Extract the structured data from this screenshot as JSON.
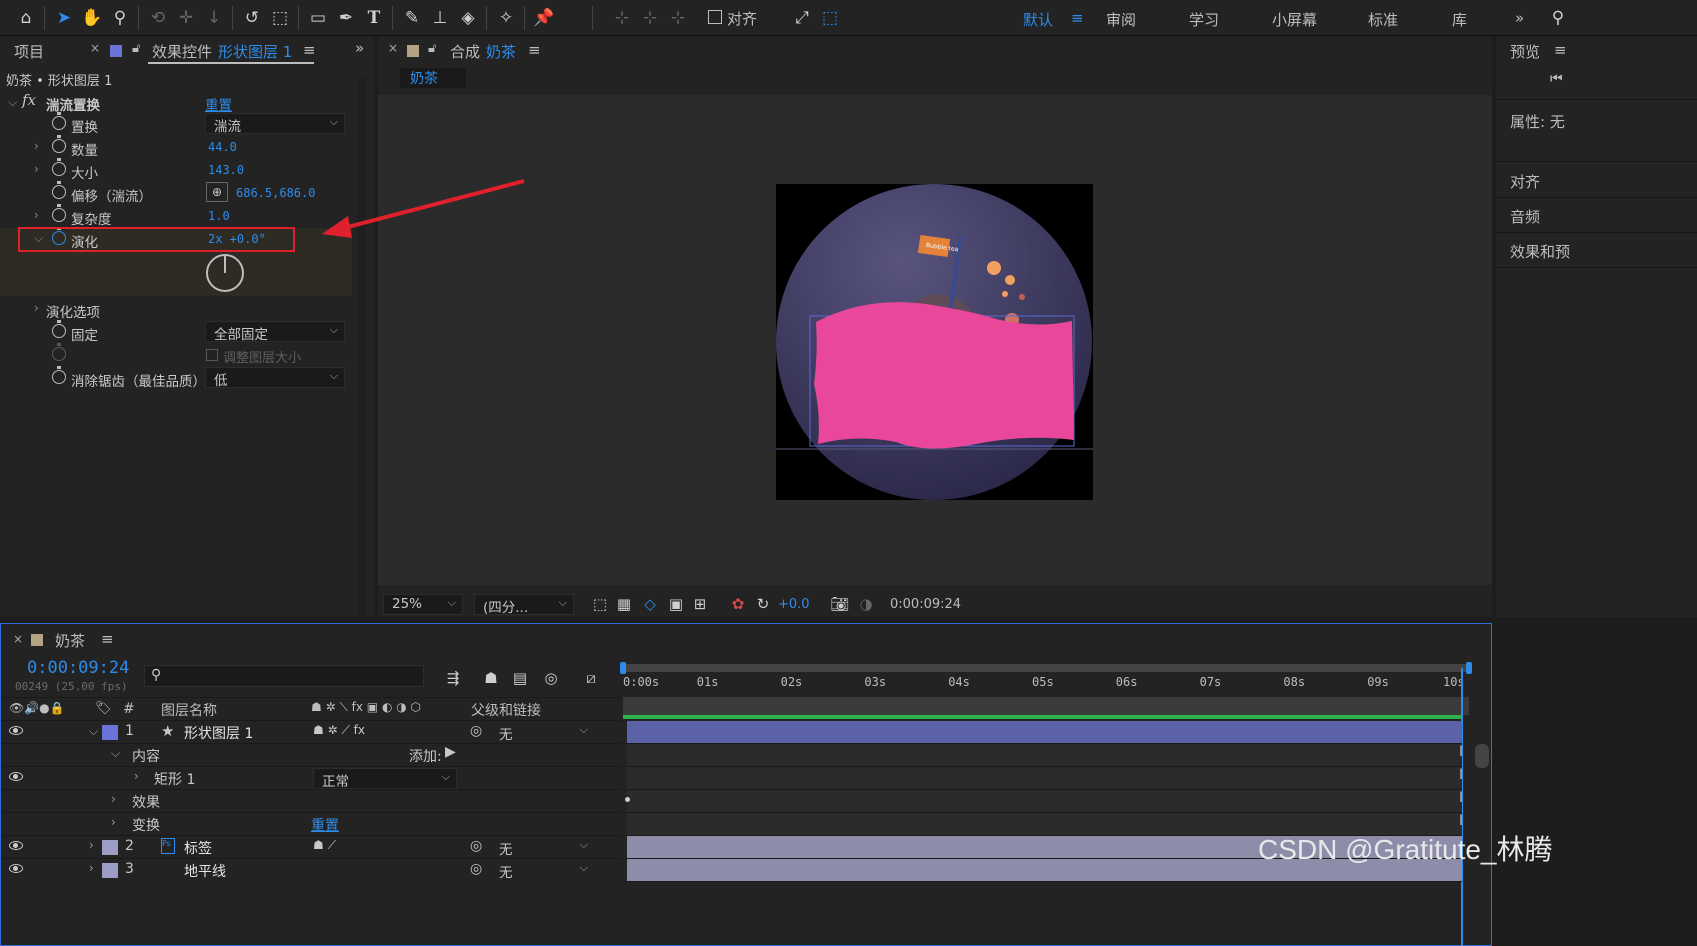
{
  "toolbar": {
    "icons": [
      "home-icon",
      "selection-arrow-icon",
      "hand-icon",
      "zoom-icon",
      "rotate-icon",
      "anchor-point-icon",
      "pan-behind-icon",
      "undo-rotate-icon",
      "snapshot-icon",
      "rectangle-icon",
      "pen-icon",
      "text-icon",
      "brush-icon",
      "clone-stamp-icon",
      "eraser-icon",
      "roto-brush-icon",
      "puppet-pin-icon"
    ],
    "align_label": "对齐",
    "workspaces": [
      "默认",
      "审阅",
      "学习",
      "小屏幕",
      "标准",
      "库"
    ],
    "active_workspace": "默认",
    "more": "»"
  },
  "project_panel": {
    "tab_project": "项目",
    "tab_effects": "效果控件",
    "tab_effects_layer": "形状图层 1",
    "more": "»",
    "breadcrumb": "奶茶 • 形状图层 1",
    "effect_name": "湍流置换",
    "reset": "重置",
    "props": [
      {
        "label": "置换",
        "type": "dropdown",
        "value": "湍流"
      },
      {
        "label": "数量",
        "type": "value",
        "value": "44.0"
      },
      {
        "label": "大小",
        "type": "value",
        "value": "143.0"
      },
      {
        "label": "偏移（湍流）",
        "type": "point",
        "value": "686.5,686.0"
      },
      {
        "label": "复杂度",
        "type": "value",
        "value": "1.0"
      },
      {
        "label": "演化",
        "type": "angle",
        "value": "2x +0.0°"
      }
    ],
    "evolution_options": "演化选项",
    "pinning_label": "固定",
    "pinning_value": "全部固定",
    "resize_layer": "调整图层大小",
    "antialias_label": "消除锯齿（最佳品质）",
    "antialias_value": "低"
  },
  "comp_panel": {
    "tab_label": "合成",
    "comp_name": "奶茶",
    "sub_tab": "奶茶",
    "zoom": "25%",
    "resolution": "(四分...",
    "exposure": "+0.0",
    "timecode": "0:00:09:24",
    "flag_text": "Bubble tea"
  },
  "right_panel": {
    "preview": "预览",
    "properties": "属性: 无",
    "align": "对齐",
    "audio": "音频",
    "effects_presets": "效果和预"
  },
  "timeline": {
    "comp_name": "奶茶",
    "timecode": "0:00:09:24",
    "frame_info": "00249 (25.00 fps)",
    "search_placeholder": "",
    "col_layer_name": "图层名称",
    "col_hash": "#",
    "col_parent": "父级和链接",
    "ruler": [
      "0:00s",
      "01s",
      "02s",
      "03s",
      "04s",
      "05s",
      "06s",
      "07s",
      "08s",
      "09s",
      "10s"
    ],
    "layers": [
      {
        "num": "1",
        "name": "形状图层 1",
        "parent": "无",
        "color": "#6b73d6"
      },
      {
        "num": "2",
        "name": "标签",
        "parent": "无",
        "color": "#9d9dc4"
      },
      {
        "num": "3",
        "name": "地平线",
        "parent": "无",
        "color": "#9d9dc4"
      }
    ],
    "contents": "内容",
    "add_label": "添加:",
    "rect": "矩形 1",
    "blend_mode": "正常",
    "effects": "效果",
    "transform": "变换",
    "reset": "重置"
  },
  "watermark": "CSDN @Gratitute_林腾",
  "colors": {
    "accent": "#2d8ceb",
    "annotation": "#e0202a",
    "shape": "#e8479a"
  }
}
